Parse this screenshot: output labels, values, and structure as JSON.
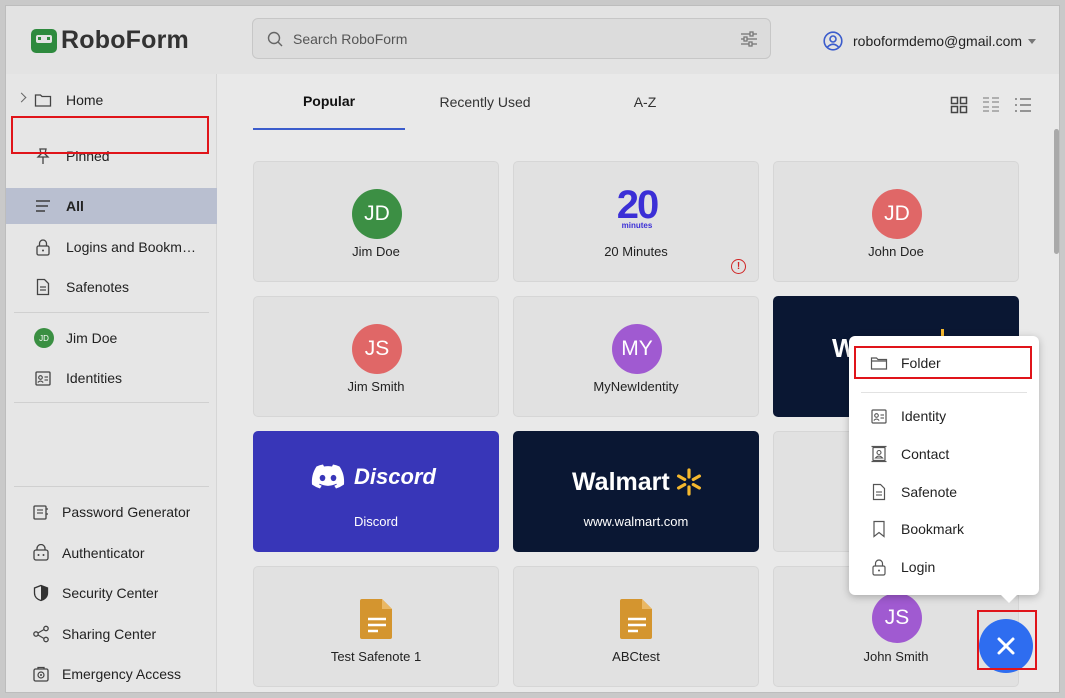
{
  "app": {
    "name": "RoboForm"
  },
  "search": {
    "placeholder": "Search RoboForm"
  },
  "account": {
    "email": "roboformdemo@gmail.com"
  },
  "sidebar": {
    "top": [
      {
        "label": "Home"
      },
      {
        "label": "Pinned"
      },
      {
        "label": "All"
      },
      {
        "label": "Logins and Bookm…"
      },
      {
        "label": "Safenotes"
      }
    ],
    "identities": [
      {
        "label": "Jim Doe",
        "badge": "JD"
      },
      {
        "label": "Identities"
      }
    ],
    "tools": [
      {
        "label": "Password Generator"
      },
      {
        "label": "Authenticator"
      },
      {
        "label": "Security Center"
      },
      {
        "label": "Sharing Center"
      },
      {
        "label": "Emergency Access"
      }
    ]
  },
  "tabs": [
    {
      "label": "Popular"
    },
    {
      "label": "Recently Used"
    },
    {
      "label": "A-Z"
    }
  ],
  "cards": [
    {
      "name": "Jim Doe",
      "initials": "JD",
      "color": "#3c8f44"
    },
    {
      "name": "20 Minutes",
      "logo_big": "20",
      "logo_small": "minutes",
      "color": "#3b2fd6"
    },
    {
      "name": "John Doe",
      "initials": "JD",
      "color": "#e06767"
    },
    {
      "name": "Jim Smith",
      "initials": "JS",
      "color": "#e06767"
    },
    {
      "name": "MyNewIdentity",
      "initials": "MY",
      "color": "#a05ad1"
    },
    {
      "name": "Discord",
      "logo": "Discord"
    },
    {
      "name": "www.walmart.com",
      "logo": "Walmart"
    },
    {
      "name": "Test Safenote 1"
    },
    {
      "name": "ABCtest"
    },
    {
      "name": "John Smith",
      "initials": "JS",
      "color": "#a05ad1"
    }
  ],
  "menu": {
    "items": [
      {
        "label": "Folder"
      },
      {
        "label": "Identity"
      },
      {
        "label": "Contact"
      },
      {
        "label": "Safenote"
      },
      {
        "label": "Bookmark"
      },
      {
        "label": "Login"
      }
    ]
  },
  "colors": {
    "accent": "#2e6df0",
    "highlight": "#e0141a",
    "brand": "#2e8a3e"
  }
}
